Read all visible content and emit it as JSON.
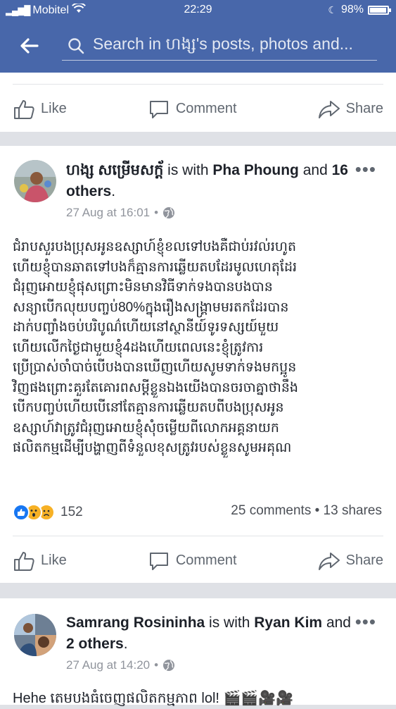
{
  "status_bar": {
    "carrier": "Mobitel",
    "time": "22:29",
    "battery": "98%"
  },
  "search": {
    "placeholder": "Search in ហង្ស's posts, photos and..."
  },
  "actions": {
    "like": "Like",
    "comment": "Comment",
    "share": "Share"
  },
  "posts": [
    {
      "author": "ហង្ស សម្រើមសក្ត័",
      "with_text": "is with",
      "tagged": "Pha Phoung",
      "and_text": "and",
      "others": "16 others",
      "date": "27 Aug at 16:01",
      "body": "ជំរាបសួរបងប្រុសអូនឧស្សាហ៍ខ្ញុំខលទៅបងគឺជាប់រវល់រហូត\nហើយខ្ញុំបានឆាតទៅបងក៏គ្មានការឆ្លើយតបដែរមូលហេតុដែរ\nជំរុញអោយខ្ញុំផុសព្រោះមិនមានវិធីទាក់ទងបានបងបាន\nសន្យាបើកលុយបញ្ចប់80%ក្នុងរឿងសង្គ្រាមមរតកដែរបាន\nដាក់បញ្ចាំងចប់បរិបូណ៌ហើយនៅស្ថានីយ៍ទូរទស្សយ៍មួយ\nហើយលើកថ្ងៃជាមួយខ្ញុំ4ដងហើយពេលនេះខ្ញុំត្រូវការ\nប្រើប្រាស់ចាំបាច់បើបងបានឃើញហើយសូមទាក់ទងមកប្អូន\nវិញផងព្រោះគួរតែគោរពសម្តីខ្លួនឯងយើងបានចរចាគ្នាថានឹង\nបើកបញ្ចប់ហើយបើនៅតែគ្មានការឆ្លើយតបពីបងប្រុសអូន\nឧស្សាហ៍វាត្រូវជំរុញអោយខ្ញុំសុំចម្លើយពីលោកអគ្គនាយក\nផលិតកម្មដើម្បីបង្ហាញពីទំនួលខុសត្រូវរបស់ខ្លួនសូមអគុណ",
      "reaction_count": "152",
      "comments": "25 comments",
      "shares": "13 shares"
    },
    {
      "author": "Samrang Rosininha",
      "with_text": "is with",
      "tagged": "Ryan Kim",
      "and_text": "and",
      "others": "2 others",
      "date": "27 Aug at 14:20",
      "body": "Hehe តេមបងធំចេញផលិតកម្មភាព lol! 🎬🎬🎥🎥"
    }
  ],
  "colors": {
    "brand": "#4867aa",
    "like_blue": "#1877f2",
    "reaction_yellow": "#f7b125"
  }
}
